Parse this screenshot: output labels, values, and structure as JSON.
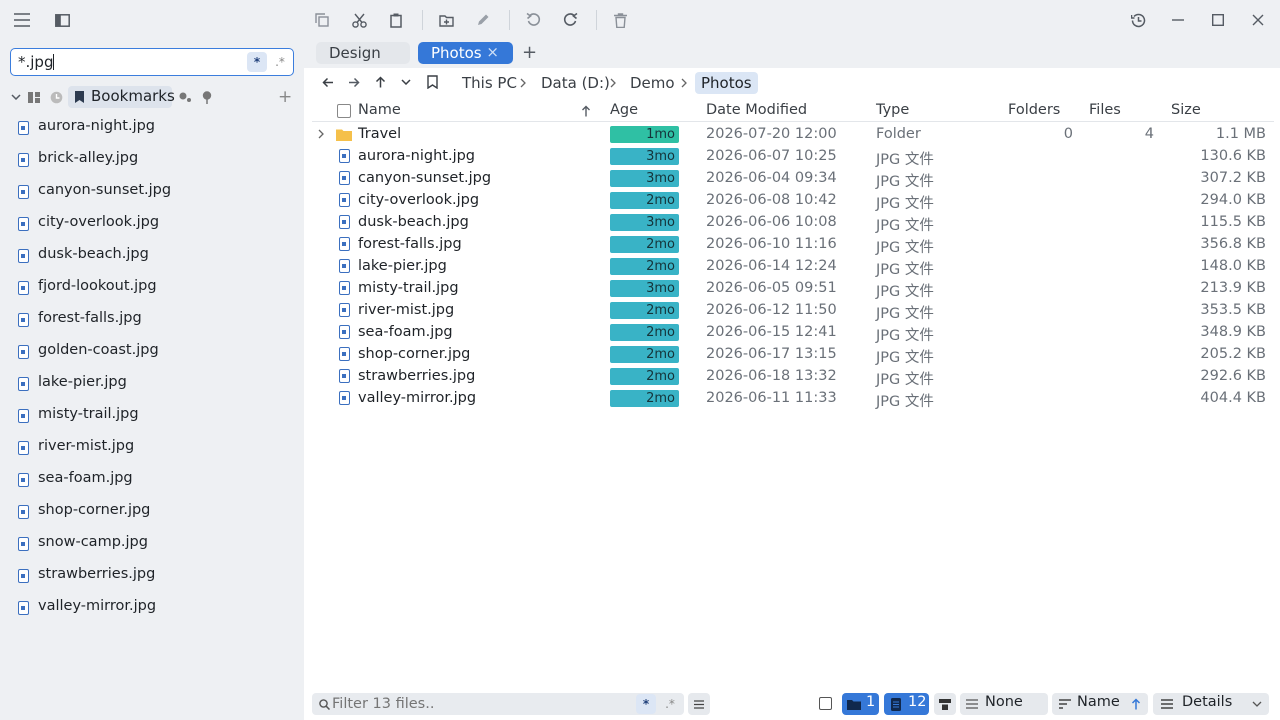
{
  "sidebar": {
    "search_value": "*.jpg",
    "wildcard_label": "*",
    "regex_label": ".*",
    "bookmarks_label": "Bookmarks",
    "add_label": "+",
    "files": [
      "aurora-night.jpg",
      "brick-alley.jpg",
      "canyon-sunset.jpg",
      "city-overlook.jpg",
      "dusk-beach.jpg",
      "fjord-lookout.jpg",
      "forest-falls.jpg",
      "golden-coast.jpg",
      "lake-pier.jpg",
      "misty-trail.jpg",
      "river-mist.jpg",
      "sea-foam.jpg",
      "shop-corner.jpg",
      "snow-camp.jpg",
      "strawberries.jpg",
      "valley-mirror.jpg"
    ]
  },
  "tabs": [
    {
      "label": "Design",
      "active": false
    },
    {
      "label": "Photos",
      "active": true,
      "close": "×"
    }
  ],
  "new_tab_label": "+",
  "breadcrumb": [
    "This PC",
    "Data (D:)",
    "Demo",
    "Photos"
  ],
  "columns": {
    "name": "Name",
    "age": "Age",
    "date": "Date Modified",
    "type": "Type",
    "folders": "Folders",
    "files": "Files",
    "size": "Size"
  },
  "rows": [
    {
      "name": "Travel",
      "kind": "folder",
      "age": "1mo",
      "date": "2026-07-20 12:00",
      "type": "Folder",
      "folders": "0",
      "files": "4",
      "size": "1.1 MB"
    },
    {
      "name": "aurora-night.jpg",
      "kind": "file",
      "age": "3mo",
      "date": "2026-06-07 10:25",
      "type": "JPG 文件",
      "size": "130.6 KB"
    },
    {
      "name": "canyon-sunset.jpg",
      "kind": "file",
      "age": "3mo",
      "date": "2026-06-04 09:34",
      "type": "JPG 文件",
      "size": "307.2 KB"
    },
    {
      "name": "city-overlook.jpg",
      "kind": "file",
      "age": "2mo",
      "date": "2026-06-08 10:42",
      "type": "JPG 文件",
      "size": "294.0 KB"
    },
    {
      "name": "dusk-beach.jpg",
      "kind": "file",
      "age": "3mo",
      "date": "2026-06-06 10:08",
      "type": "JPG 文件",
      "size": "115.5 KB"
    },
    {
      "name": "forest-falls.jpg",
      "kind": "file",
      "age": "2mo",
      "date": "2026-06-10 11:16",
      "type": "JPG 文件",
      "size": "356.8 KB"
    },
    {
      "name": "lake-pier.jpg",
      "kind": "file",
      "age": "2mo",
      "date": "2026-06-14 12:24",
      "type": "JPG 文件",
      "size": "148.0 KB"
    },
    {
      "name": "misty-trail.jpg",
      "kind": "file",
      "age": "3mo",
      "date": "2026-06-05 09:51",
      "type": "JPG 文件",
      "size": "213.9 KB"
    },
    {
      "name": "river-mist.jpg",
      "kind": "file",
      "age": "2mo",
      "date": "2026-06-12 11:50",
      "type": "JPG 文件",
      "size": "353.5 KB"
    },
    {
      "name": "sea-foam.jpg",
      "kind": "file",
      "age": "2mo",
      "date": "2026-06-15 12:41",
      "type": "JPG 文件",
      "size": "348.9 KB"
    },
    {
      "name": "shop-corner.jpg",
      "kind": "file",
      "age": "2mo",
      "date": "2026-06-17 13:15",
      "type": "JPG 文件",
      "size": "205.2 KB"
    },
    {
      "name": "strawberries.jpg",
      "kind": "file",
      "age": "2mo",
      "date": "2026-06-18 13:32",
      "type": "JPG 文件",
      "size": "292.6 KB"
    },
    {
      "name": "valley-mirror.jpg",
      "kind": "file",
      "age": "2mo",
      "date": "2026-06-11 11:33",
      "type": "JPG 文件",
      "size": "404.4 KB"
    }
  ],
  "status": {
    "filter_placeholder": "Filter 13 files..",
    "wildcard_label": "*",
    "regex_label": ".*",
    "folder_count": "1",
    "file_count": "12",
    "group_label": "None",
    "sort_label": "Name",
    "view_label": "Details"
  },
  "colors": {
    "accent": "#3578d8",
    "age_fresh": "#2fc0a4",
    "age_normal": "#39b3c6",
    "folder": "#f5c04a",
    "file_icon": "#3b6fbf"
  }
}
